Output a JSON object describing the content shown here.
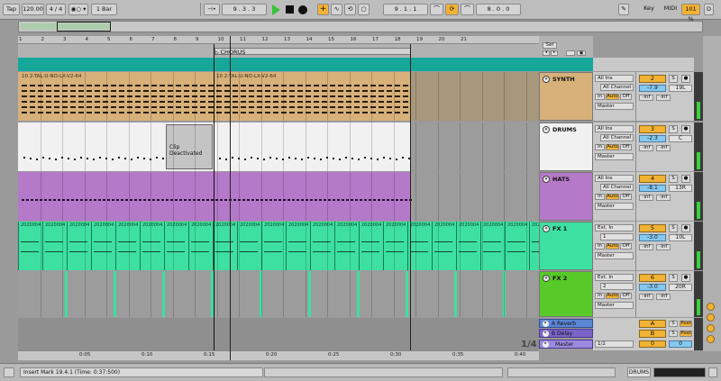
{
  "transport": {
    "tap": "Tap",
    "tempo": "120.00",
    "meter": "4 / 4",
    "metro": "1 Bar",
    "arrangement_position": "9 .  3 .  3",
    "loop_start": "9 .  1 .  1",
    "loop_length": "8 .  0 .  0",
    "key_label": "Key",
    "midi_label": "MIDI",
    "cpu": "101 %",
    "d_label": "D"
  },
  "ruler": {
    "bars": [
      "1",
      "2",
      "3",
      "4",
      "5",
      "6",
      "7",
      "8",
      "9",
      "10",
      "11",
      "12",
      "13",
      "14",
      "15",
      "16",
      "17",
      "18",
      "19",
      "20",
      "21"
    ],
    "set_label": "Set",
    "locator": "CHORUS"
  },
  "tracks": [
    {
      "name": "SYNTH",
      "color": "#d7b07a",
      "clip_name": "10 2-TAL-U-NO-LX-V2-64",
      "clip_name_2": "10 2-TAL-U-NO-LX-V2-64",
      "input_type": "All Ins",
      "input_channel": "All Channel",
      "output": "Master",
      "number": "2",
      "volume": "-7.9",
      "pan": "19L",
      "monitor": [
        "In",
        "Auto",
        "Off"
      ],
      "send_a": "-inf",
      "send_b": "-inf"
    },
    {
      "name": "DRUMS",
      "color": "#f1f1f1",
      "clip_label": "Clip Deactivated",
      "input_type": "All Ins",
      "input_channel": "All Channel",
      "output": "Master",
      "number": "3",
      "volume": "-2.3",
      "pan": "C",
      "monitor": [
        "In",
        "Auto",
        "Off"
      ],
      "send_a": "-inf",
      "send_b": "-inf"
    },
    {
      "name": "HATS",
      "color": "#b579c9",
      "input_type": "All Ins",
      "input_channel": "All Channel",
      "output": "Master",
      "number": "4",
      "volume": "-8.1",
      "pan": "13R",
      "monitor": [
        "In",
        "Auto",
        "Off"
      ],
      "send_a": "-inf",
      "send_b": "-inf"
    },
    {
      "name": "FX 1",
      "color": "#3de0a0",
      "clip_name": "2020004",
      "input_type": "Ext. In",
      "input_channel": "1",
      "output": "Master",
      "number": "5",
      "volume": "-3.0",
      "pan": "10L",
      "monitor": [
        "In",
        "Auto",
        "Off"
      ],
      "send_a": "-inf",
      "send_b": "-inf"
    },
    {
      "name": "FX 2",
      "color": "#57c928",
      "input_type": "Ext. In",
      "input_channel": "2",
      "output": "Master",
      "number": "6",
      "volume": "-3.0",
      "pan": "20R",
      "monitor": [
        "In",
        "Auto",
        "Off"
      ],
      "send_a": "-inf",
      "send_b": "-inf"
    }
  ],
  "returns": [
    {
      "name": "A Reverb",
      "letter": "A",
      "send_mode": "Post"
    },
    {
      "name": "B Delay",
      "letter": "B",
      "send_mode": "Post"
    },
    {
      "name": "Master",
      "channel": "1/2",
      "vol": "0",
      "pan": "0"
    }
  ],
  "timeline": [
    "0:05",
    "0:10",
    "0:15",
    "0:20",
    "0:25",
    "0:30",
    "0:35",
    "0:40"
  ],
  "zoom_page": "1/4",
  "status": {
    "message": "Insert Mark 19.4.1 (Time: 0:37:500)",
    "track_label": "DRUMS"
  },
  "colors": {
    "accent": "#f2b233",
    "play": "#3bc13b",
    "teal": "#1aaa9a"
  }
}
